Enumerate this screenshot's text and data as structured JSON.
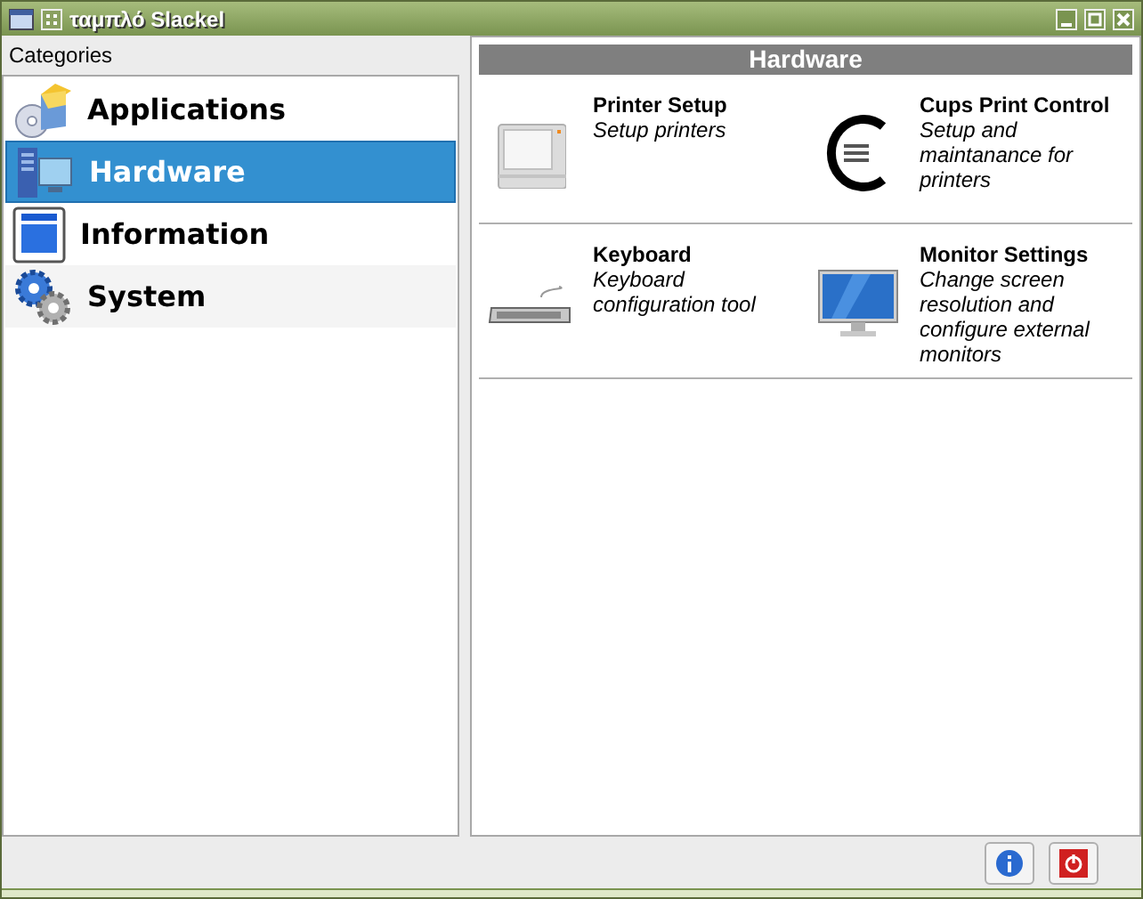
{
  "window": {
    "title": "ταμπλό Slackel"
  },
  "sidebar": {
    "title": "Categories",
    "items": [
      {
        "label": "Applications",
        "kind": "box",
        "selected": false
      },
      {
        "label": "Hardware",
        "kind": "computer",
        "selected": true
      },
      {
        "label": "Information",
        "kind": "document",
        "selected": false
      },
      {
        "label": "System",
        "kind": "gears",
        "selected": false
      }
    ]
  },
  "panel": {
    "title": "Hardware",
    "items": [
      {
        "name": "Printer Setup",
        "description": "Setup printers",
        "kind": "printer"
      },
      {
        "name": "Cups Print Control",
        "description": "Setup and maintanance for printers",
        "kind": "cups"
      },
      {
        "name": "Keyboard",
        "description": "Keyboard configuration tool",
        "kind": "keyboard"
      },
      {
        "name": "Monitor Settings",
        "description": "Change screen resolution and configure external monitors",
        "kind": "monitor"
      }
    ]
  }
}
